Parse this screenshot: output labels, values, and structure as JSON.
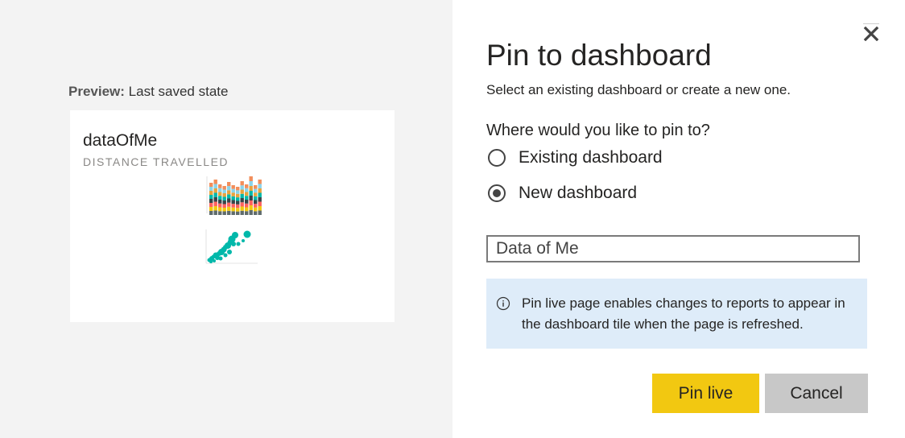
{
  "preview": {
    "label_bold": "Preview:",
    "label_text": "Last saved state",
    "card_title": "dataOfMe",
    "card_subtitle": "DISTANCE TRAVELLED"
  },
  "dialog": {
    "title": "Pin to dashboard",
    "description": "Select an existing dashboard or create a new one.",
    "question": "Where would you like to pin to?",
    "options": [
      {
        "label": "Existing dashboard",
        "selected": false
      },
      {
        "label": "New dashboard",
        "selected": true
      }
    ],
    "name_input_value": "Data of Me",
    "info_text": "Pin live page enables changes to reports to appear in the dashboard tile when the page is refreshed.",
    "buttons": {
      "pin_live": "Pin live",
      "cancel": "Cancel"
    },
    "icons": {
      "close": "close-icon",
      "info": "info-icon"
    }
  },
  "colors": {
    "left_background": "#f3f3f3",
    "primary_button": "#f2c811",
    "secondary_button": "#c8c8c8",
    "info_background": "#deecf9",
    "thumbnail_palette": [
      "#f28e5b",
      "#8ad4eb",
      "#e8a33d",
      "#01b8aa",
      "#374649",
      "#fd625e",
      "#f2c80f",
      "#5f6b6d"
    ]
  }
}
